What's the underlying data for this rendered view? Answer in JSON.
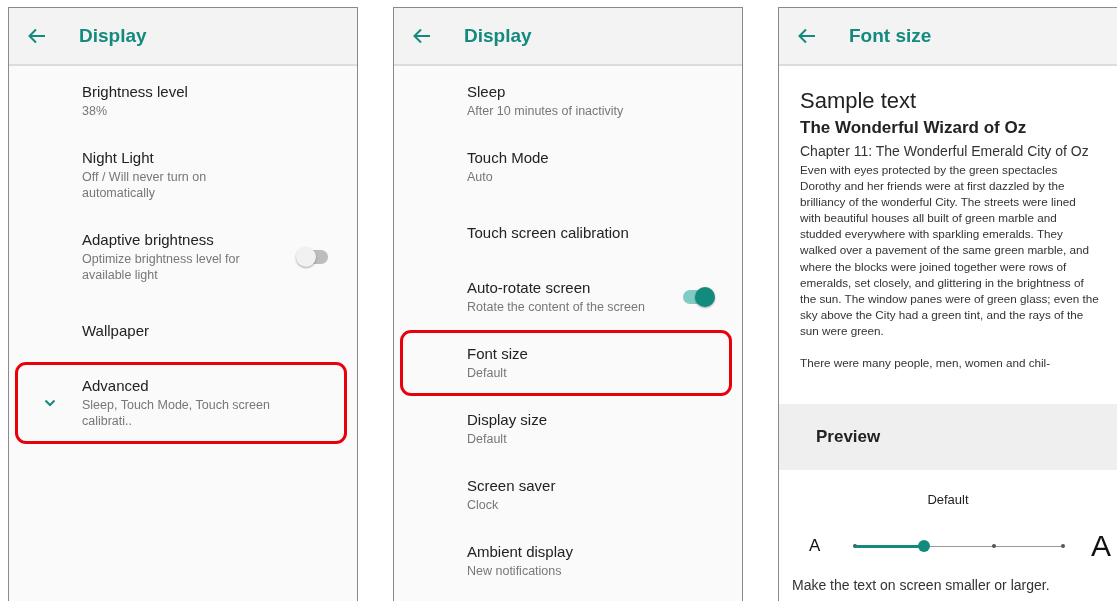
{
  "screens": [
    {
      "kind": "settings",
      "title": "Display",
      "items": [
        {
          "kind": "text",
          "title": "Brightness level",
          "summary": "38%",
          "highlighted": false
        },
        {
          "kind": "text",
          "title": "Night Light",
          "summary": "Off / Will never turn on automatically",
          "highlighted": false
        },
        {
          "kind": "switch",
          "title": "Adaptive brightness",
          "summary": "Optimize brightness level for available light",
          "on": false,
          "highlighted": false
        },
        {
          "kind": "text",
          "title": "Wallpaper",
          "highlighted": false
        },
        {
          "kind": "expander",
          "title": "Advanced",
          "summary": "Sleep, Touch Mode, Touch screen calibrati..",
          "highlighted": true
        }
      ]
    },
    {
      "kind": "settings",
      "title": "Display",
      "items": [
        {
          "kind": "text",
          "title": "Sleep",
          "summary": "After 10 minutes of inactivity",
          "highlighted": false
        },
        {
          "kind": "text",
          "title": "Touch Mode",
          "summary": "Auto",
          "highlighted": false
        },
        {
          "kind": "text",
          "title": "Touch screen calibration",
          "highlighted": false
        },
        {
          "kind": "switch",
          "title": "Auto-rotate screen",
          "summary": "Rotate the content of the screen",
          "on": true,
          "highlighted": false
        },
        {
          "kind": "text",
          "title": "Font size",
          "summary": "Default",
          "highlighted": true
        },
        {
          "kind": "text",
          "title": "Display size",
          "summary": "Default",
          "highlighted": false
        },
        {
          "kind": "text",
          "title": "Screen saver",
          "summary": "Clock",
          "highlighted": false
        },
        {
          "kind": "text",
          "title": "Ambient display",
          "summary": "New notifications",
          "highlighted": false
        }
      ]
    },
    {
      "kind": "font_size",
      "title": "Font size",
      "sample": {
        "heading": "Sample text",
        "book_title": "The Wonderful Wizard of Oz",
        "chapter": "Chapter 11: The Wonderful Emerald City of Oz",
        "paragraphs": [
          "Even with eyes protected by the green spectacles Dorothy and her friends were at first dazzled by the brilliancy of the wonderful City. The streets were lined with beautiful houses all built of green marble and studded everywhere with sparkling emeralds. They walked over a pavement of the same green marble, and where the blocks were joined together were rows of emeralds, set closely, and glittering in the brightness of the sun. The window panes were of green glass; even the sky above the City had a green tint, and the rays of the sun were green.",
          "There were many people, men, women and chil-"
        ]
      },
      "preview_label": "Preview",
      "slider": {
        "value_label": "Default",
        "small_label": "A",
        "large_label": "A",
        "level": 0.3333
      },
      "description": "Make the text on screen smaller or larger."
    }
  ]
}
